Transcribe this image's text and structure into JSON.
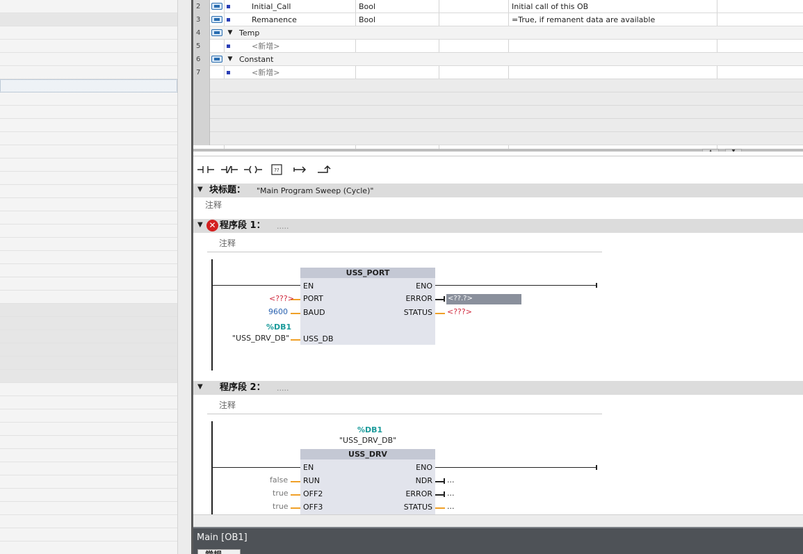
{
  "interface_table": {
    "rows": [
      {
        "num": "2",
        "name": "Initial_Call",
        "type": "Bool",
        "comment": "Initial call of this OB"
      },
      {
        "num": "3",
        "name": "Remanence",
        "type": "Bool",
        "comment": "=True, if remanent data are available"
      },
      {
        "num": "4",
        "name": "Temp"
      },
      {
        "num": "5",
        "name": "<新增>"
      },
      {
        "num": "6",
        "name": "Constant"
      },
      {
        "num": "7",
        "name": "<新增>"
      }
    ]
  },
  "toolbar": {
    "buttons": [
      "normally-open-contact",
      "normally-closed-contact",
      "assignment-coil",
      "empty-box",
      "open-branch",
      "close-branch"
    ]
  },
  "block": {
    "title_label": "块标题：",
    "title_value": "\"Main Program Sweep (Cycle)\"",
    "comment": "注释"
  },
  "network1": {
    "label": "程序段 1：",
    "dots": ".....",
    "comment": "注释",
    "fb_name": "USS_PORT",
    "pins_in": [
      "EN",
      "PORT",
      "BAUD",
      "USS_DB"
    ],
    "pins_out": [
      "ENO",
      "ERROR",
      "STATUS"
    ],
    "port_value": "<???>",
    "baud_value": "9600",
    "db_number": "%DB1",
    "db_name": "\"USS_DRV_DB\"",
    "error_value": "<??.?>",
    "status_value": "<???>"
  },
  "network2": {
    "label": "程序段 2：",
    "dots": ".....",
    "comment": "注释",
    "instance_db": "%DB1",
    "instance_name": "\"USS_DRV_DB\"",
    "fb_name": "USS_DRV",
    "pins_in": [
      "EN",
      "RUN",
      "OFF2",
      "OFF3"
    ],
    "pins_out": [
      "ENO",
      "NDR",
      "ERROR",
      "STATUS"
    ],
    "run_value": "false",
    "off2_value": "true",
    "off3_value": "true",
    "ndr_value": "...",
    "error_value": "...",
    "status_value": "..."
  },
  "inspector": {
    "title": "Main [OB1]",
    "tab_general": "常规"
  },
  "colors": {
    "error_red": "#d32020",
    "pin_orange": "#f0a028",
    "db_teal": "#1a9a9a",
    "value_blue": "#2a62b0",
    "missing_red": "#d0283c"
  }
}
